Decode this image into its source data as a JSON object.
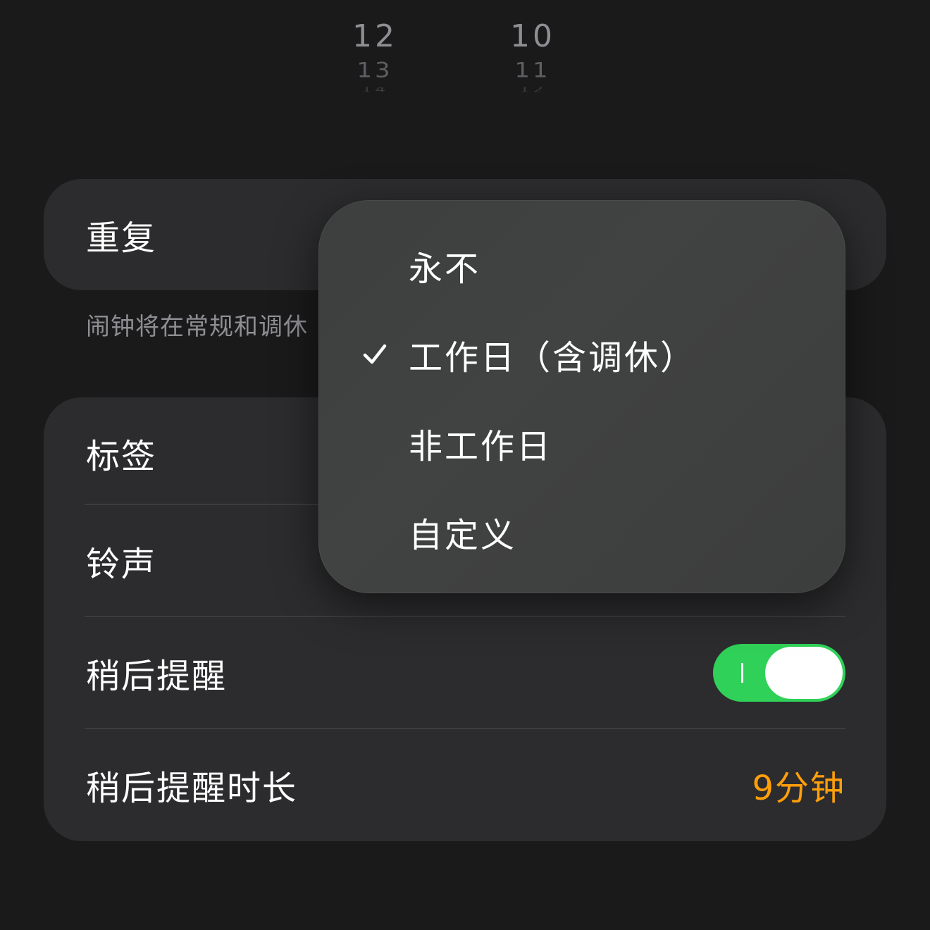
{
  "picker": {
    "hours": [
      "12",
      "13",
      "14"
    ],
    "minutes": [
      "10",
      "11",
      "12"
    ]
  },
  "repeat": {
    "label": "重复"
  },
  "footnote": "闹钟将在常规和调休",
  "settings": {
    "label_row": "标签",
    "ringtone_row": "铃声",
    "snooze_row": "稍后提醒",
    "snooze_enabled": true,
    "snooze_duration_row": "稍后提醒时长",
    "snooze_duration_value": "9分钟"
  },
  "repeat_menu": {
    "options": [
      {
        "label": "永不",
        "selected": false
      },
      {
        "label": "工作日（含调休）",
        "selected": true
      },
      {
        "label": "非工作日",
        "selected": false
      },
      {
        "label": "自定义",
        "selected": false
      }
    ]
  },
  "colors": {
    "background": "#1a1a1b",
    "card": "#2c2c2e",
    "toggle_on": "#30d158",
    "accent_orange": "#ff9f0a",
    "secondary_text": "#8e8e93"
  }
}
